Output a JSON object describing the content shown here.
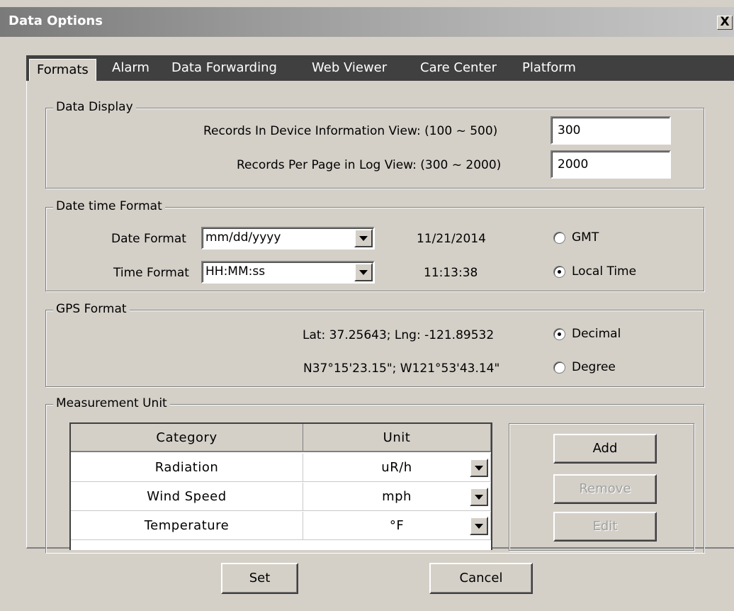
{
  "window": {
    "title": "Data Options",
    "close_glyph": "X"
  },
  "tabs": [
    {
      "label": "Formats"
    },
    {
      "label": "Alarm"
    },
    {
      "label": "Data Forwarding"
    },
    {
      "label": "Web Viewer"
    },
    {
      "label": "Care Center"
    },
    {
      "label": "Platform"
    }
  ],
  "data_display": {
    "legend": "Data Display",
    "records_device_label": "Records In Device Information View: (100 ~ 500)",
    "records_device_value": "300",
    "records_log_label": "Records Per Page in Log View: (300 ~ 2000)",
    "records_log_value": "2000"
  },
  "datetime": {
    "legend": "Date time Format",
    "date_format_label": "Date Format",
    "date_format_value": "mm/dd/yyyy",
    "date_preview": "11/21/2014",
    "time_format_label": "Time Format",
    "time_format_value": "HH:MM:ss",
    "time_preview": "11:13:38",
    "gmt_label": "GMT",
    "local_label": "Local Time",
    "selected": "local"
  },
  "gps": {
    "legend": "GPS Format",
    "decimal_preview": "Lat: 37.25643; Lng: -121.89532",
    "degree_preview": "N37°15'23.15\"; W121°53'43.14\"",
    "decimal_label": "Decimal",
    "degree_label": "Degree",
    "selected": "decimal"
  },
  "measurement": {
    "legend": "Measurement Unit",
    "columns": [
      "Category",
      "Unit"
    ],
    "rows": [
      {
        "category": "Radiation",
        "unit": "uR/h"
      },
      {
        "category": "Wind Speed",
        "unit": "mph"
      },
      {
        "category": "Temperature",
        "unit": "°F"
      }
    ],
    "add_label": "Add",
    "remove_label": "Remove",
    "edit_label": "Edit"
  },
  "footer": {
    "set_label": "Set",
    "cancel_label": "Cancel"
  }
}
